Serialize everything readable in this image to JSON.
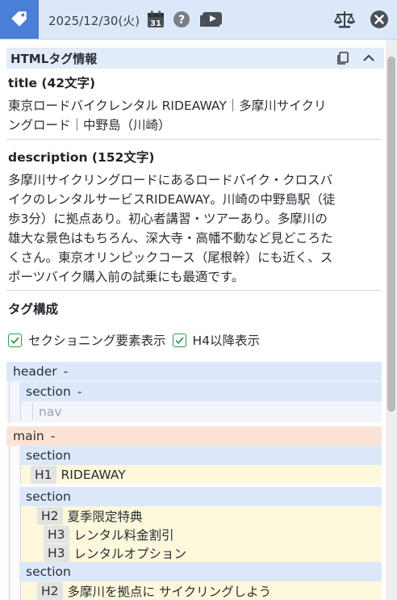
{
  "topbar": {
    "date": "2025/12/30(火)",
    "calendar_day": "31",
    "icons": [
      "tag-icon",
      "calendar-icon",
      "help-icon",
      "video-icon",
      "scale-icon",
      "close-icon"
    ]
  },
  "panel": {
    "title": "HTMLタグ情報",
    "icons": [
      "copy-icon",
      "collapse-icon"
    ]
  },
  "title_section": {
    "heading": "title (42文字)",
    "lines": [
      "東京ロードバイクレンタル RIDEAWAY｜多摩川サイクリ",
      "ングロード｜中野島（川崎）"
    ]
  },
  "description_section": {
    "heading": "description (152文字)",
    "lines": [
      "多摩川サイクリングロードにあるロードバイク・クロスバ",
      "イクのレンタルサービスRIDEAWAY。川崎の中野島駅（徒",
      "歩3分）に拠点あり。初心者講習・ツアーあり。多摩川の",
      "雄大な景色はもちろん、深大寺・高幡不動など見どころた",
      "くさん。東京オリンピックコース（尾根幹）にも近く、ス",
      "ポーツバイク購入前の試乗にも最適です。"
    ]
  },
  "tag_structure": {
    "heading": "タグ構成",
    "options": [
      {
        "label": "セクショニング要素表示",
        "checked": true
      },
      {
        "label": "H4以降表示",
        "checked": true
      }
    ]
  },
  "tree": {
    "header": {
      "tag": "header",
      "toggle": "-"
    },
    "header_section": {
      "tag": "section",
      "toggle": "-"
    },
    "nav": {
      "tag": "nav"
    },
    "main": {
      "tag": "main",
      "toggle": "-"
    },
    "section1": {
      "tag": "section",
      "h1": {
        "level": "H1",
        "text": "RIDEAWAY"
      }
    },
    "section2": {
      "tag": "section",
      "h2": {
        "level": "H2",
        "text": "夏季限定特典"
      },
      "h3a": {
        "level": "H3",
        "text": "レンタル料金割引"
      },
      "h3b": {
        "level": "H3",
        "text": "レンタルオプション"
      }
    },
    "section3": {
      "tag": "section",
      "h2": {
        "level": "H2",
        "text": "多摩川を拠点に サイクリングしよう"
      }
    }
  },
  "colors": {
    "topbar_bg": "#dce8fa",
    "logo_bg": "#4a7fd8",
    "header_node_bg": "#dce8fa",
    "main_node_bg": "#fbe4d6",
    "section_in_main_bg": "#fdf8dc",
    "checkbox_green": "#2f9a52"
  }
}
